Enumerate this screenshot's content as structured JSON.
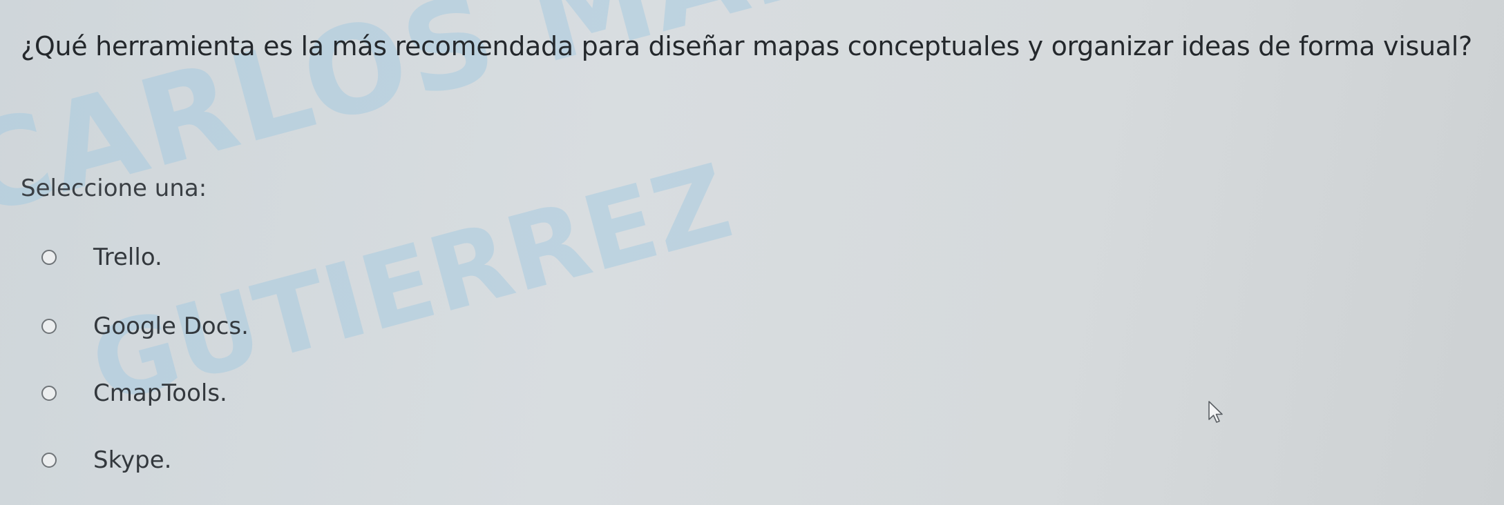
{
  "question": {
    "text": "¿Qué herramienta es la más recomendada para diseñar mapas conceptuales y organizar ideas de forma visual?"
  },
  "prompt": {
    "text": "Seleccione una:"
  },
  "options": [
    {
      "label": "Trello.",
      "selected": false
    },
    {
      "label": "Google Docs.",
      "selected": false
    },
    {
      "label": "CmapTools.",
      "selected": false
    },
    {
      "label": "Skype.",
      "selected": false
    }
  ],
  "watermark": {
    "line1": "CARLOS MARIO REYES",
    "line2": "GUTIERREZ",
    "color": "#a8cbe0"
  },
  "cursor": {
    "icon": "mouse-pointer-icon"
  }
}
